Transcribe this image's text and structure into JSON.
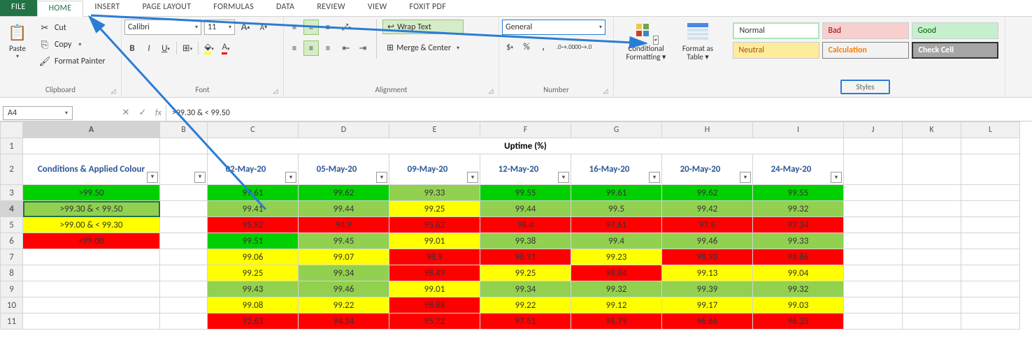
{
  "ribbon": {
    "tabs": [
      "FILE",
      "HOME",
      "INSERT",
      "PAGE LAYOUT",
      "FORMULAS",
      "DATA",
      "REVIEW",
      "VIEW",
      "FOXIT PDF"
    ],
    "active_tab": "HOME",
    "clipboard": {
      "paste": "Paste",
      "cut": "Cut",
      "copy": "Copy",
      "format_painter": "Format Painter",
      "label": "Clipboard"
    },
    "font": {
      "name": "Calibri",
      "size": "11",
      "label": "Font"
    },
    "alignment": {
      "wrap_text": "Wrap Text",
      "merge_center": "Merge & Center",
      "label": "Alignment"
    },
    "number": {
      "format": "General",
      "label": "Number"
    },
    "cond_fmt": "Conditional Formatting",
    "format_table": "Format as Table",
    "styles": {
      "normal": "Normal",
      "bad": "Bad",
      "good": "Good",
      "neutral": "Neutral",
      "calc": "Calculation",
      "check": "Check Cell",
      "label": "Styles"
    }
  },
  "formula_bar": {
    "name_box": "A4",
    "fx": "fx",
    "value": ">99.30 & < 99.50"
  },
  "grid": {
    "col_headers": [
      "A",
      "B",
      "C",
      "D",
      "E",
      "F",
      "G",
      "H",
      "I",
      "J",
      "K",
      "L"
    ],
    "row_headers": [
      "1",
      "2",
      "3",
      "4",
      "5",
      "6",
      "7",
      "8",
      "9",
      "10",
      "11"
    ],
    "title": "Uptime (%)",
    "cond_header": "Conditions & Applied Colour",
    "dates": [
      "02-May-20",
      "05-May-20",
      "09-May-20",
      "12-May-20",
      "16-May-20",
      "20-May-20",
      "24-May-20"
    ],
    "conditions": [
      {
        "label": ">99.50",
        "color": "#00d000"
      },
      {
        "label": ">99.30 & < 99.50",
        "color": "#92d050"
      },
      {
        "label": ">99.00 & < 99.30",
        "color": "#ffff00"
      },
      {
        "label": "<99.00",
        "color": "#ff0000"
      }
    ],
    "data": [
      [
        "99.61",
        "99.62",
        "99.33",
        "99.55",
        "99.61",
        "99.62",
        "99.55"
      ],
      [
        "99.41",
        "99.44",
        "99.25",
        "99.44",
        "99.5",
        "99.42",
        "99.32"
      ],
      [
        "95.92",
        "94.9",
        "95.62",
        "98.4",
        "97.61",
        "97.5",
        "97.34"
      ],
      [
        "99.51",
        "99.45",
        "99.01",
        "99.38",
        "99.4",
        "99.46",
        "99.33"
      ],
      [
        "99.06",
        "99.07",
        "98.9",
        "98.91",
        "99.23",
        "98.93",
        "98.86"
      ],
      [
        "99.25",
        "99.34",
        "98.49",
        "99.25",
        "98.84",
        "99.13",
        "99.04"
      ],
      [
        "99.43",
        "99.46",
        "99.01",
        "99.34",
        "99.32",
        "99.39",
        "99.32"
      ],
      [
        "99.08",
        "99.22",
        "98.88",
        "99.22",
        "99.12",
        "99.17",
        "99.03"
      ],
      [
        "92.63",
        "94.24",
        "95.22",
        "97.51",
        "96.79",
        "96.66",
        "96.35"
      ]
    ],
    "selected_cell": "A4"
  },
  "colors": {
    "gt9950": "#00d000",
    "gt9930": "#92d050",
    "gt9900": "#ffff00",
    "lt9900": "#ff0000"
  }
}
